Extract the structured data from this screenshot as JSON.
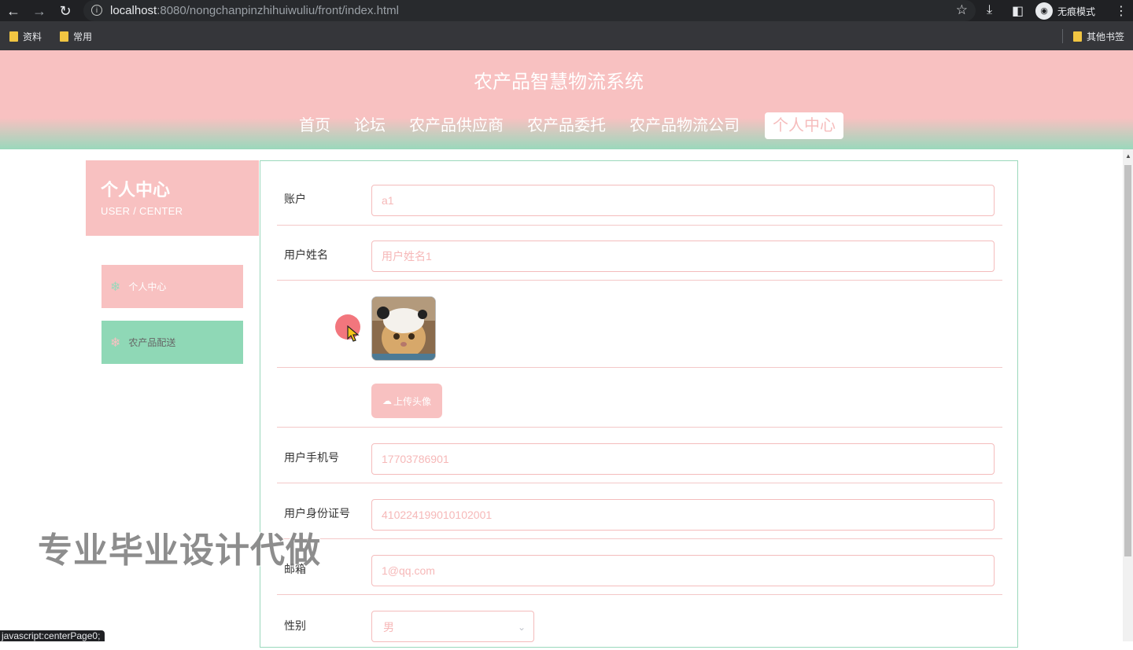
{
  "browser": {
    "url_host": "localhost",
    "url_rest": ":8080/nongchanpinzhihuiwuliu/front/index.html",
    "incognito_label": "无痕模式",
    "bookmarks": [
      {
        "label": "资料"
      },
      {
        "label": "常用"
      }
    ],
    "other_bookmarks": "其他书签",
    "status_text": "javascript:centerPage0;"
  },
  "site": {
    "title": "农产品智慧物流系统",
    "menu": [
      {
        "label": "首页",
        "active": false
      },
      {
        "label": "论坛",
        "active": false
      },
      {
        "label": "农产品供应商",
        "active": false
      },
      {
        "label": "农产品委托",
        "active": false
      },
      {
        "label": "农产品物流公司",
        "active": false
      },
      {
        "label": "个人中心",
        "active": true
      }
    ]
  },
  "sidebar": {
    "title": "个人中心",
    "subtitle": "USER / CENTER",
    "items": [
      {
        "label": "个人中心"
      },
      {
        "label": "农产品配送"
      }
    ]
  },
  "form": {
    "account": {
      "label": "账户",
      "value": "a1"
    },
    "user_name": {
      "label": "用户姓名",
      "value": "用户姓名1"
    },
    "upload_label": "上传头像",
    "phone": {
      "label": "用户手机号",
      "value": "17703786901"
    },
    "id_number": {
      "label": "用户身份证号",
      "value": "410224199010102001"
    },
    "email": {
      "label": "邮箱",
      "value": "1@qq.com"
    },
    "gender": {
      "label": "性别",
      "value": "男"
    }
  },
  "watermark": "专业毕业设计代做",
  "colors": {
    "pink": "#f8c1c1",
    "green": "#9ad8bc",
    "chrome_dark": "#202124"
  }
}
